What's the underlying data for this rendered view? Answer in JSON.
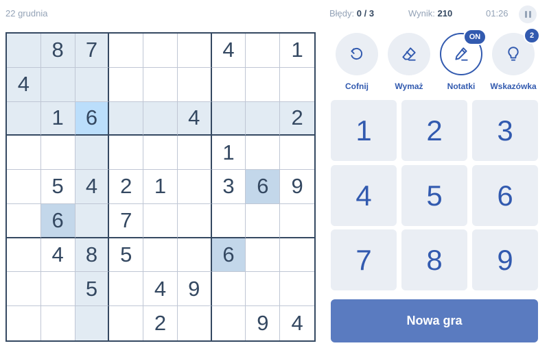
{
  "header": {
    "date": "22 grudnia",
    "errors_label": "Błędy:",
    "errors_value": "0 / 3",
    "score_label": "Wynik:",
    "score_value": "210",
    "timer": "01:26",
    "pause_icon": "pause-icon"
  },
  "board": {
    "cells": [
      [
        "",
        "8",
        "7",
        "",
        "",
        "",
        "4",
        "",
        "1"
      ],
      [
        "4",
        "",
        "",
        "",
        "",
        "",
        "",
        "",
        ""
      ],
      [
        "",
        "1",
        "6",
        "",
        "",
        "4",
        "",
        "",
        "2"
      ],
      [
        "",
        "",
        "",
        "",
        "",
        "",
        "1",
        "",
        ""
      ],
      [
        "",
        "5",
        "4",
        "2",
        "1",
        "",
        "3",
        "6",
        "9"
      ],
      [
        "",
        "6",
        "",
        "7",
        "",
        "",
        "",
        "",
        ""
      ],
      [
        "",
        "4",
        "8",
        "5",
        "",
        "",
        "6",
        "",
        ""
      ],
      [
        "",
        "",
        "5",
        "",
        "4",
        "9",
        "",
        "",
        ""
      ],
      [
        "",
        "",
        "",
        "",
        "2",
        "",
        "",
        "9",
        "4"
      ]
    ],
    "selected": [
      2,
      2
    ],
    "same_number_cells": [
      [
        4,
        7
      ],
      [
        5,
        1
      ],
      [
        6,
        6
      ]
    ],
    "colors": {
      "highlight": "#e2ebf3",
      "same_number": "#c3d7ea",
      "selected": "#bbdefb",
      "digit": "#344861"
    }
  },
  "actions": [
    {
      "label": "Cofnij",
      "icon": "undo-icon",
      "badge": ""
    },
    {
      "label": "Wymaż",
      "icon": "eraser-icon",
      "badge": ""
    },
    {
      "label": "Notatki",
      "icon": "pencil-icon",
      "badge": "ON"
    },
    {
      "label": "Wskazówka",
      "icon": "lightbulb-icon",
      "badge": "2"
    }
  ],
  "numpad": [
    "1",
    "2",
    "3",
    "4",
    "5",
    "6",
    "7",
    "8",
    "9"
  ],
  "new_game_label": "Nowa gra",
  "accent_color": "#325aaf"
}
